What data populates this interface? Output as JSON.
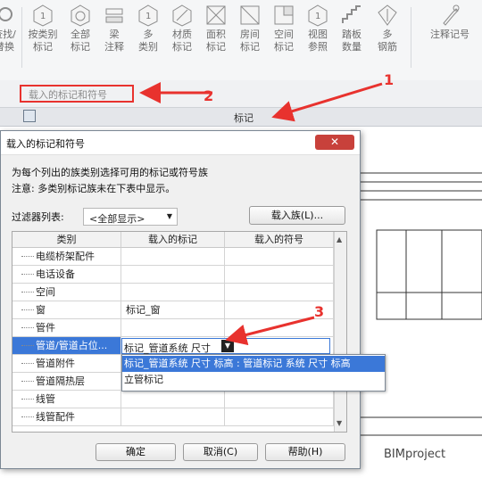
{
  "ribbon": {
    "items": [
      {
        "label1": "查找/",
        "label2": "替换",
        "icon": "find-replace-icon"
      },
      {
        "label1": "按类别",
        "label2": "标记",
        "icon": "tag-by-category-icon"
      },
      {
        "label1": "全部",
        "label2": "标记",
        "icon": "tag-all-icon"
      },
      {
        "label1": "梁",
        "label2": "注释",
        "icon": "beam-annotation-icon"
      },
      {
        "label1": "多",
        "label2": "类别",
        "icon": "multi-category-icon"
      },
      {
        "label1": "材质",
        "label2": "标记",
        "icon": "material-tag-icon"
      },
      {
        "label1": "面积",
        "label2": "标记",
        "icon": "area-tag-icon"
      },
      {
        "label1": "房间",
        "label2": "标记",
        "icon": "room-tag-icon"
      },
      {
        "label1": "空间",
        "label2": "标记",
        "icon": "space-tag-icon"
      },
      {
        "label1": "视图",
        "label2": "参照",
        "icon": "view-reference-icon"
      },
      {
        "label1": "踏板",
        "label2": "数量",
        "icon": "tread-number-icon"
      },
      {
        "label1": "多",
        "label2": "钢筋",
        "icon": "multi-rebar-icon"
      },
      {
        "label1": "注释记号",
        "label2": "",
        "icon": "keynote-icon"
      }
    ]
  },
  "optionsbar": {
    "loaded_tags_label": "载入的标记和符号"
  },
  "propstrip": {
    "label": "标记"
  },
  "annotations": {
    "one": "1",
    "two": "2",
    "three": "3"
  },
  "dialog": {
    "title": "载入的标记和符号",
    "close_symbol": "✕",
    "desc1": "为每个列出的族类别选择可用的标记或符号族",
    "desc2": "注意: 多类别标记族未在下表中显示。",
    "filter_label": "过滤器列表:",
    "filter_value": "<全部显示>",
    "load_family_button": "载入族(L)...",
    "columns": [
      "类别",
      "载入的标记",
      "载入的符号"
    ],
    "rows": [
      {
        "category": "电缆桥架配件",
        "tag": "",
        "symbol": ""
      },
      {
        "category": "电话设备",
        "tag": "",
        "symbol": ""
      },
      {
        "category": "空间",
        "tag": "",
        "symbol": ""
      },
      {
        "category": "窗",
        "tag": "标记_窗",
        "symbol": ""
      },
      {
        "category": "管件",
        "tag": "",
        "symbol": ""
      },
      {
        "category": "管道/管道占位...",
        "tag": "标记_管道系统 尺寸",
        "symbol": ""
      },
      {
        "category": "管道附件",
        "tag": "",
        "symbol": ""
      },
      {
        "category": "管道隔热层",
        "tag": "",
        "symbol": ""
      },
      {
        "category": "线管",
        "tag": "",
        "symbol": ""
      },
      {
        "category": "线管配件",
        "tag": "",
        "symbol": ""
      }
    ],
    "dropdown_options": [
      "标记_管道系统 尺寸 标高 : 管道标记 系统 尺寸 标高",
      "立管标记"
    ],
    "ok_button": "确定",
    "cancel_button": "取消(C)",
    "help_button": "帮助(H)"
  },
  "watermark": "BIMproject",
  "colors": {
    "accent": "#e8322e",
    "selection": "#3b78d8",
    "close": "#c8413b"
  }
}
